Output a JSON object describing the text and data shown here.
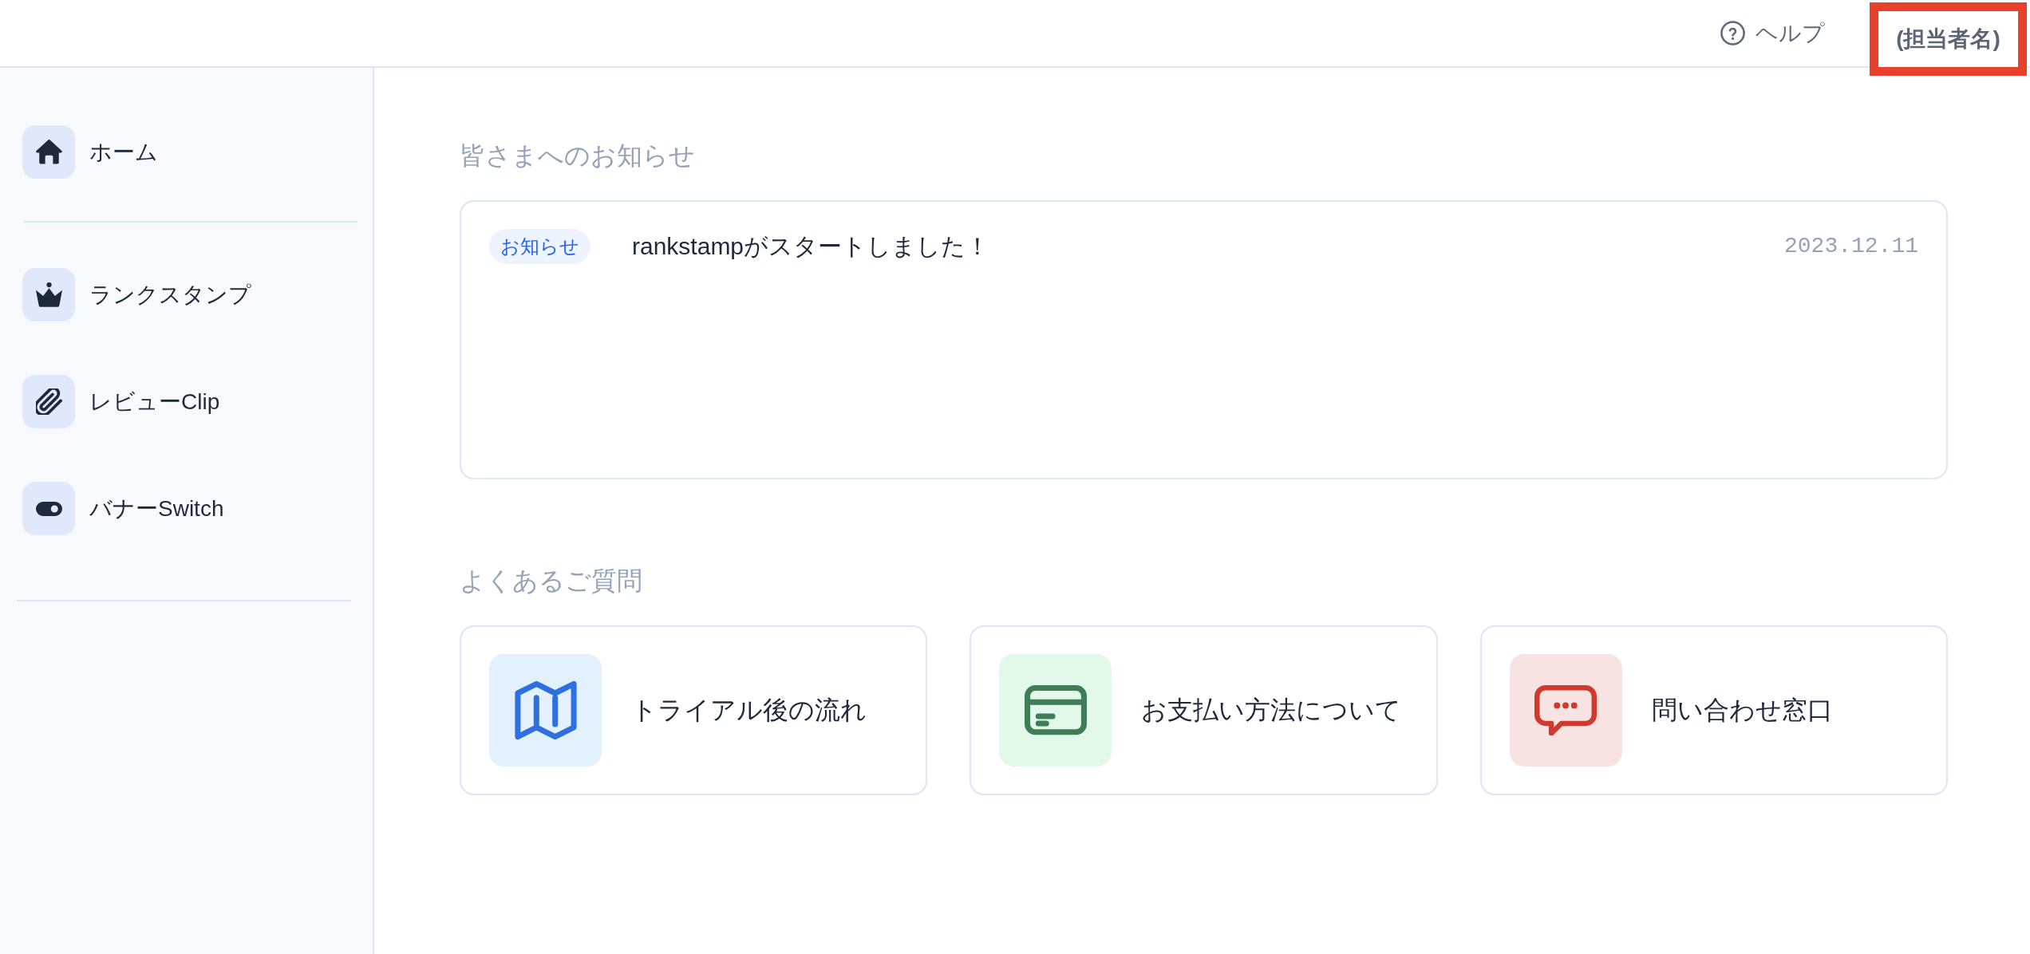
{
  "header": {
    "help": {
      "label": "ヘルプ"
    },
    "user": {
      "name": "(担当者名)",
      "highlighted": true
    }
  },
  "sidebar": {
    "sections": [
      {
        "items": [
          {
            "kind": "home",
            "label": "ホーム"
          }
        ]
      },
      {
        "items": [
          {
            "kind": "rankstamp",
            "label": "ランクスタンプ"
          },
          {
            "kind": "clip",
            "label": "レビューClip"
          },
          {
            "kind": "switch",
            "label": "バナーSwitch"
          }
        ]
      }
    ]
  },
  "notices": {
    "title": "皆さまへのお知らせ",
    "items": [
      {
        "tag": "お知らせ",
        "text": "rankstampがスタートしました！",
        "date": "2023.12.11"
      }
    ]
  },
  "faq": {
    "title": "よくあるご質問",
    "items": [
      {
        "kind": "flow",
        "label": "トライアル後の流れ"
      },
      {
        "kind": "payment",
        "label": "お支払い方法について"
      },
      {
        "kind": "contact",
        "label": "問い合わせ窓口"
      }
    ]
  }
}
